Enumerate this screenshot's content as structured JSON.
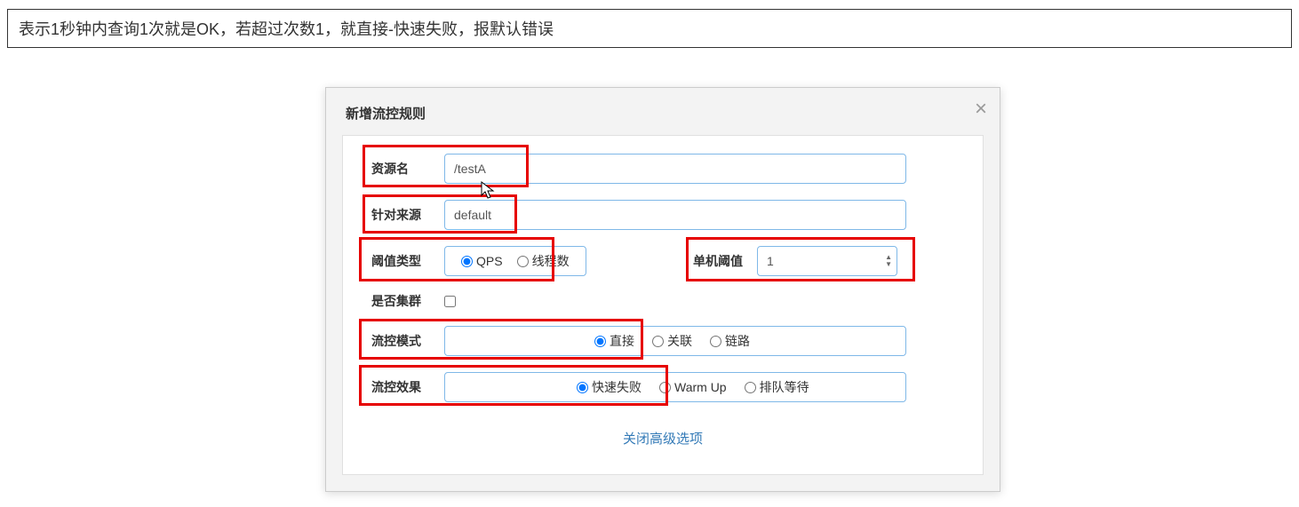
{
  "note": "表示1秒钟内查询1次就是OK，若超过次数1，就直接-快速失败，报默认错误",
  "modal": {
    "title": "新增流控规则",
    "close": "×"
  },
  "form": {
    "resource_label": "资源名",
    "resource_value": "/testA",
    "source_label": "针对来源",
    "source_value": "default",
    "threshold_type_label": "阈值类型",
    "threshold_type_qps": "QPS",
    "threshold_type_thread": "线程数",
    "single_threshold_label": "单机阈值",
    "single_threshold_value": "1",
    "cluster_label": "是否集群",
    "mode_label": "流控模式",
    "mode_direct": "直接",
    "mode_relate": "关联",
    "mode_link": "链路",
    "effect_label": "流控效果",
    "effect_fail": "快速失败",
    "effect_warmup": "Warm Up",
    "effect_queue": "排队等待",
    "advanced_link": "关闭高级选项"
  }
}
